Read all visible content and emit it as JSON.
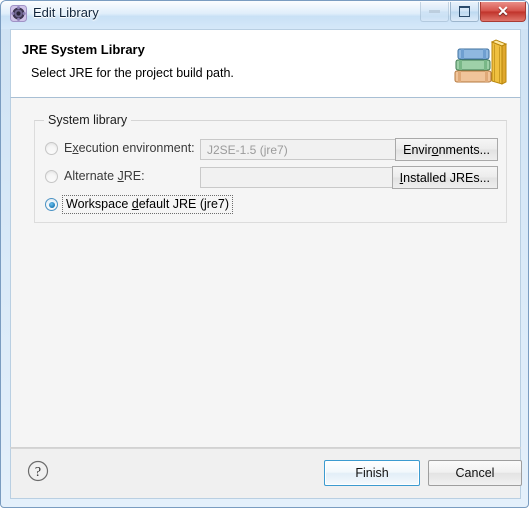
{
  "window": {
    "title": "Edit Library",
    "icon": "eclipse-library-icon",
    "buttons": {
      "minimize": "minimize-button",
      "maximize": "maximize-button",
      "close_label": "✕"
    }
  },
  "header": {
    "title": "JRE System Library",
    "subtitle": "Select JRE for the project build path.",
    "icon": "books-stack-icon"
  },
  "main": {
    "group": {
      "label": "System library",
      "options": [
        {
          "id": "execution-environment",
          "label_pre": "E",
          "label_mnemonic": "x",
          "label_post": "ecution environment:",
          "label_full": "Execution environment:",
          "selected": false,
          "enabled": false,
          "combo_value": "J2SE-1.5 (jre7)",
          "combo_placeholder": "",
          "button": {
            "label_pre": "Envir",
            "label_mnemonic": "o",
            "label_post": "nments...",
            "label_full": "Environments..."
          }
        },
        {
          "id": "alternate-jre",
          "label_pre": "Alternate ",
          "label_mnemonic": "J",
          "label_post": "RE:",
          "label_full": "Alternate JRE:",
          "selected": false,
          "enabled": false,
          "combo_value": "",
          "combo_placeholder": "",
          "button": {
            "label_pre": "",
            "label_mnemonic": "I",
            "label_post": "nstalled JREs...",
            "label_full": "Installed JREs..."
          }
        },
        {
          "id": "workspace-default-jre",
          "label_pre": "Workspace ",
          "label_mnemonic": "d",
          "label_post": "efault JRE (jre7)",
          "label_full": "Workspace default JRE (jre7)",
          "selected": true,
          "enabled": true,
          "focused": true
        }
      ]
    }
  },
  "footer": {
    "help_icon": "question-mark-icon",
    "finish_label": "Finish",
    "cancel_label": "Cancel"
  },
  "colors": {
    "accent": "#3c9bd0",
    "radio_selected": "#1d7ab5",
    "close_button": "#c0332b",
    "title_gradient_top": "#cfe2f3",
    "content_bg": "#f5f5f5",
    "header_bg": "#ffffff"
  }
}
